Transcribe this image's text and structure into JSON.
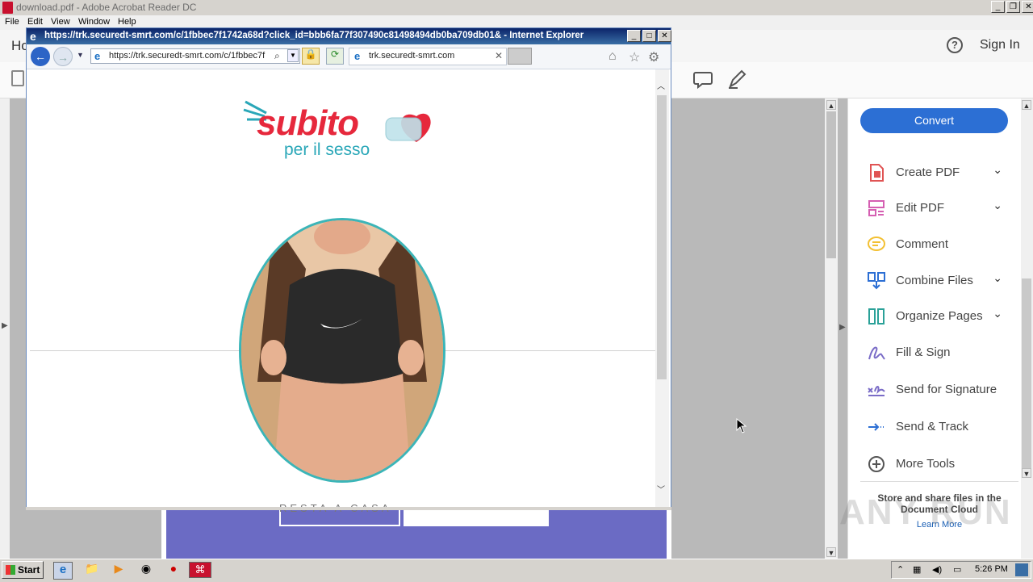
{
  "acrobat": {
    "title": "download.pdf - Adobe Acrobat Reader DC",
    "menu": [
      "File",
      "Edit",
      "View",
      "Window",
      "Help"
    ],
    "home_tab": "Ho",
    "sign_in": "Sign In",
    "help_icon": "help-icon"
  },
  "right_panel": {
    "convert_label": "Convert",
    "tools": [
      {
        "label": "Create PDF",
        "icon": "create-pdf-icon",
        "color": "#e05454"
      },
      {
        "label": "Edit PDF",
        "icon": "edit-pdf-icon",
        "color": "#d55fb2"
      },
      {
        "label": "Comment",
        "icon": "comment-icon",
        "color": "#f3c033"
      },
      {
        "label": "Combine Files",
        "icon": "combine-files-icon",
        "color": "#2c6fd4"
      },
      {
        "label": "Organize Pages",
        "icon": "organize-pages-icon",
        "color": "#2aa198"
      },
      {
        "label": "Fill & Sign",
        "icon": "fill-sign-icon",
        "color": "#7a6cc7"
      },
      {
        "label": "Send for Signature",
        "icon": "send-signature-icon",
        "color": "#7a6cc7"
      },
      {
        "label": "Send & Track",
        "icon": "send-track-icon",
        "color": "#2c6fd4"
      },
      {
        "label": "More Tools",
        "icon": "more-tools-icon",
        "color": "#555555"
      }
    ],
    "promo_text": "Store and share files in the Document Cloud",
    "promo_link": "Learn More",
    "watermark": "ANY RUN"
  },
  "ie": {
    "title": "https://trk.securedt-smrt.com/c/1fbbec7f1742a68d?click_id=bbb6fa77f307490c81498494db0ba709db01& - Internet Explorer",
    "address": "https://trk.securedt-smrt.com/c/1fbbec7f",
    "tab_title": "trk.securedt-smrt.com"
  },
  "page": {
    "logo_main": "subito",
    "logo_sub": "per il sesso",
    "subtext": "RESTA A CASA"
  },
  "taskbar": {
    "start_label": "Start",
    "clock": "5:26 PM"
  },
  "colors": {
    "accent": "#2c6fd4",
    "ie_title": "#0b246a",
    "oval_border": "#3bb5b8",
    "logo_red": "#e6283c",
    "logo_teal": "#2aa7b8"
  }
}
